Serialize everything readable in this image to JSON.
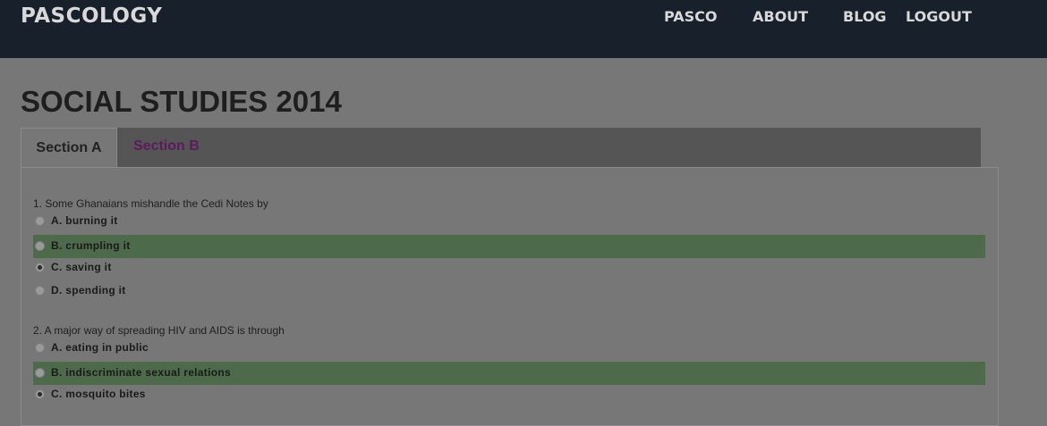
{
  "brand": "PASCOLOGY",
  "nav": {
    "items": [
      "PASCO",
      "ABOUT",
      "BLOG",
      "LOGOUT"
    ]
  },
  "page": {
    "title": "SOCIAL STUDIES 2014"
  },
  "tabs": [
    "Section A",
    "Section B"
  ],
  "questions": [
    {
      "text": "1. Some Ghanaians mishandle the Cedi Notes by",
      "options": [
        {
          "label": "A. burning it",
          "selected": false,
          "highlighted": false
        },
        {
          "label": "B. crumpling it",
          "selected": false,
          "highlighted": true
        },
        {
          "label": "C. saving it",
          "selected": true,
          "highlighted": false
        },
        {
          "label": "D. spending it",
          "selected": false,
          "highlighted": false
        }
      ]
    },
    {
      "text": "2. A major way of spreading HIV and AIDS is through",
      "options": [
        {
          "label": "A. eating in public",
          "selected": false,
          "highlighted": false
        },
        {
          "label": "B. indiscriminate sexual relations",
          "selected": false,
          "highlighted": true
        },
        {
          "label": "C. mosquito bites",
          "selected": true,
          "highlighted": false
        }
      ]
    }
  ],
  "colors": {
    "navbar": "#18202c",
    "highlight": "#4d6a4a",
    "tab_b_text": "#5c1b5c"
  }
}
